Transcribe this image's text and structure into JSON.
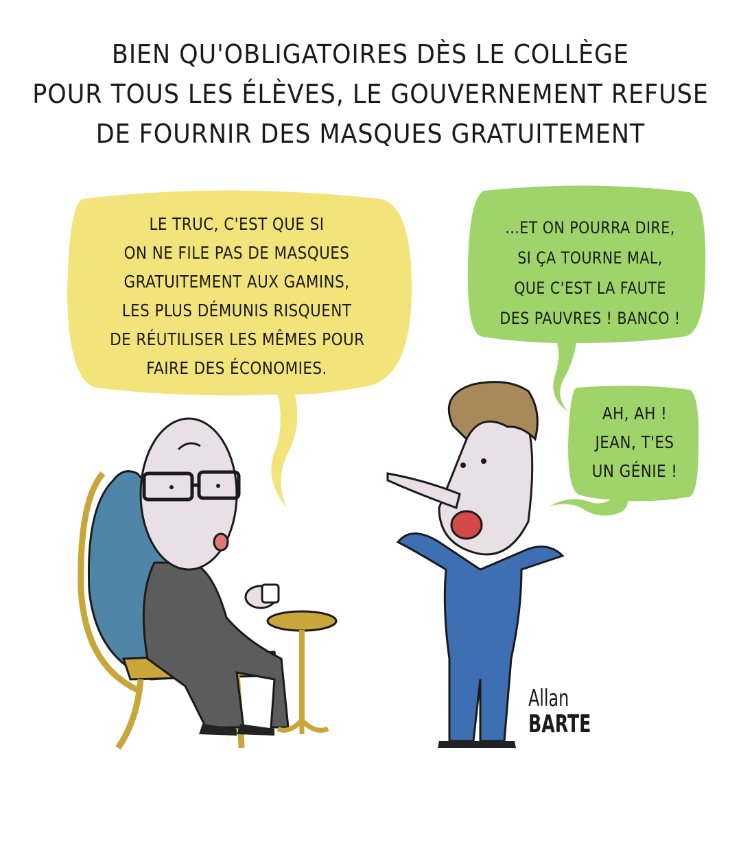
{
  "caption": {
    "lines": [
      "Bien qu'obligatoires dès le collège",
      "pour tous les élèves, le gouvernement refuse",
      "de fournir des masques gratuitement"
    ]
  },
  "bubbles": {
    "yellow": {
      "lines": [
        "Le truc, c'est que si",
        "on ne file pas de masques",
        "gratuitement aux gamins,",
        "les plus démunis risquent",
        "de réutiliser les mêmes pour",
        "faire des économies."
      ]
    },
    "green_top": {
      "lines": [
        "...Et on pourra dire,",
        "si ça tourne mal,",
        "que c'est la faute",
        "des pauvres ! Banco !"
      ]
    },
    "green_bottom": {
      "lines": [
        "Ah, ah !",
        "Jean, t'es",
        "un génie !"
      ]
    }
  },
  "signature": {
    "line1": "Allan",
    "line2": "BARTE"
  },
  "colors": {
    "yellow_bubble": "#f2e47a",
    "green_bubble": "#9fd46a",
    "chair": "#4f86a8",
    "gold": "#c9a63a",
    "suit_blue": "#3f6fb3",
    "suit_grey": "#5c5c5c",
    "hair": "#a88a5a"
  }
}
